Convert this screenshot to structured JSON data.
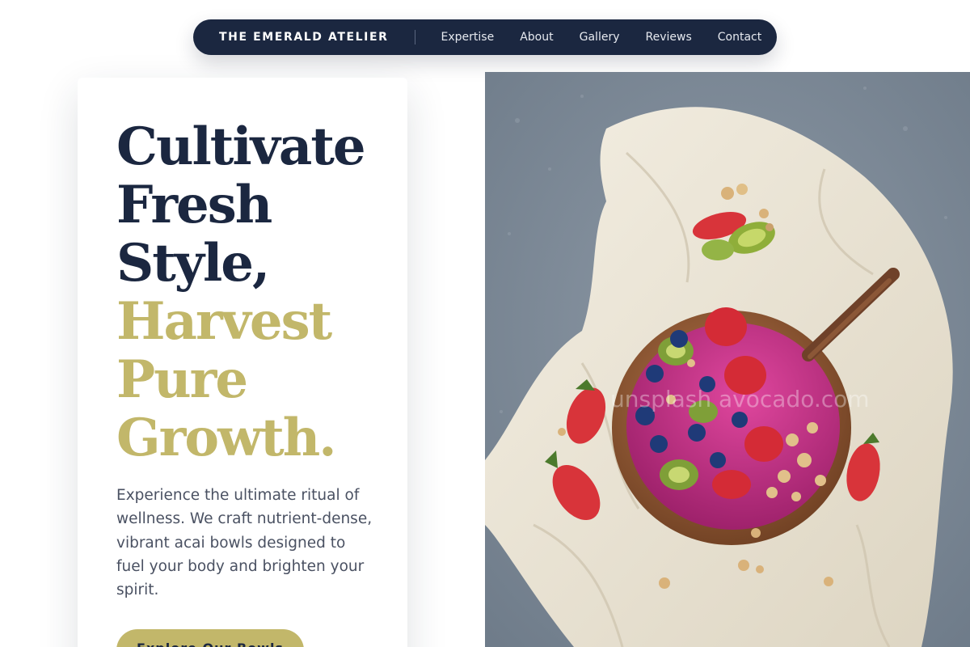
{
  "nav": {
    "brand": "THE EMERALD ATELIER",
    "links": [
      "Expertise",
      "About",
      "Gallery",
      "Reviews",
      "Contact"
    ]
  },
  "hero": {
    "headline_dark": [
      "Cultivate",
      "Fresh",
      "Style,"
    ],
    "headline_gold": [
      "Harvest",
      "Pure",
      "Growth."
    ],
    "body": "Experience the ultimate ritual of wellness. We craft nutrient-dense, vibrant acai bowls designed to fuel your body and brighten your spirit.",
    "cta_label": "Explore Our Bowls",
    "image_watermark": "unsplash avocado.com"
  },
  "colors": {
    "navy": "#1b2740",
    "gold": "#c2b76a",
    "body_text": "#4a5162",
    "stone": "#7d8a98",
    "linen": "#ece6d6",
    "acai": "#c0287f"
  },
  "icons": {
    "hero_image": "acai-bowl-photo"
  }
}
